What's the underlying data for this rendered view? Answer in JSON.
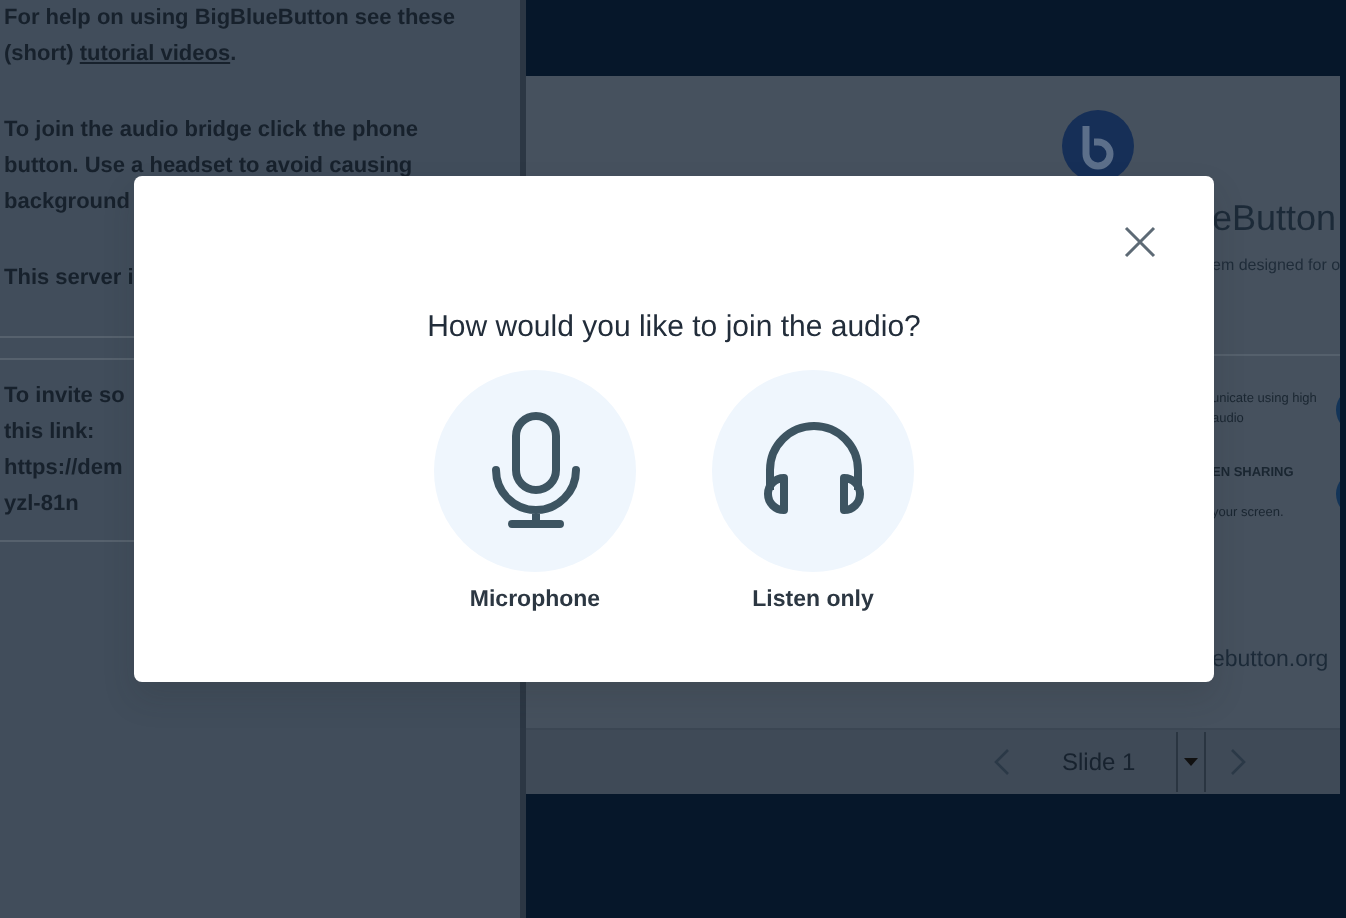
{
  "sidebar": {
    "paragraphs": [
      {
        "text": "For help on using BigBlueButton see these (short) ",
        "link": "tutorial videos",
        "after": "."
      },
      {
        "text": "To join the audio bridge click the phone button. Use a headset to avoid causing background"
      },
      {
        "text": "This server i"
      }
    ],
    "invite_lines": [
      "To invite so",
      "this link:",
      "https://dem",
      "yzl-81n"
    ]
  },
  "presentation": {
    "slide": {
      "title": "eButton",
      "subtitle": "em designed for o",
      "features": [
        {
          "lines": [
            "unicate using high",
            "audio"
          ]
        },
        {
          "title": "EN SHARING",
          "lines": [
            "your screen."
          ]
        }
      ],
      "link": "ebutton.org"
    },
    "slide_nav": {
      "label": "Slide 1"
    }
  },
  "modal": {
    "title": "How would you like to join the audio?",
    "options": [
      {
        "kind": "microphone",
        "label": "Microphone"
      },
      {
        "kind": "listen",
        "label": "Listen only"
      }
    ]
  }
}
